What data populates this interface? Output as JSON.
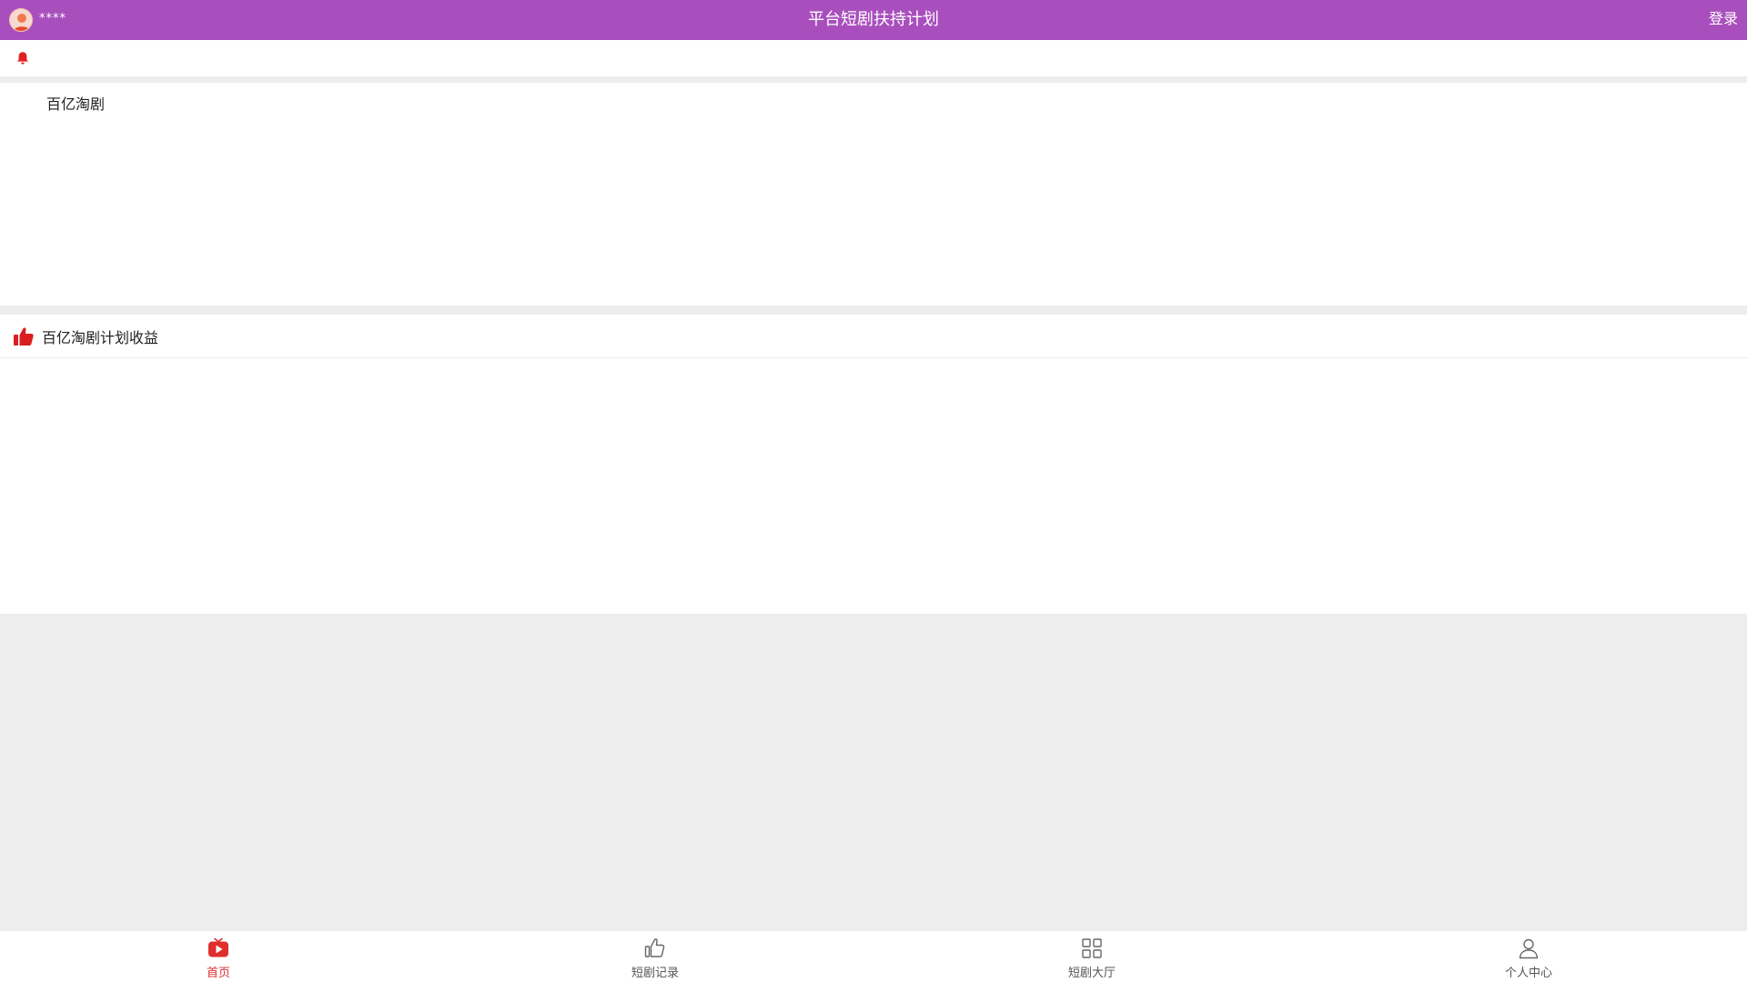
{
  "header": {
    "username": "****",
    "title": "平台短剧扶持计划",
    "login_label": "登录",
    "background_color": "#a94fbd"
  },
  "notice": {
    "icon": "bell-icon",
    "icon_color": "#e02020"
  },
  "section1": {
    "label": "百亿淘剧"
  },
  "section2": {
    "icon": "thumbs-up-icon",
    "icon_color": "#d91f1f",
    "label": "百亿淘剧计划收益"
  },
  "tabbar": {
    "active_color": "#e02e2e",
    "items": [
      {
        "label": "首页",
        "icon": "play-tv-icon",
        "active": true
      },
      {
        "label": "短剧记录",
        "icon": "thumbs-up-outline-icon",
        "active": false
      },
      {
        "label": "短剧大厅",
        "icon": "grid-icon",
        "active": false
      },
      {
        "label": "个人中心",
        "icon": "user-icon",
        "active": false
      }
    ]
  }
}
